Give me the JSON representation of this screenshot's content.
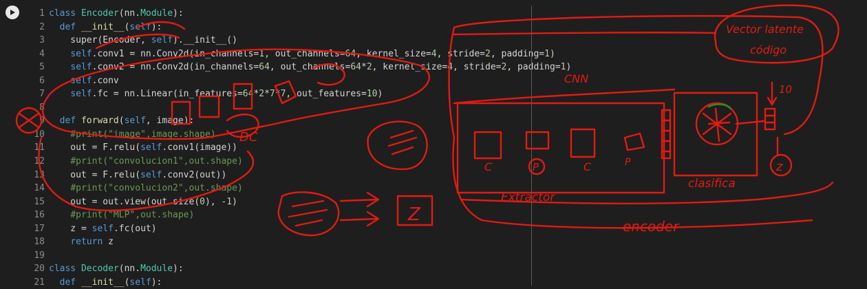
{
  "code_lines": [
    {
      "n": "1",
      "parts": [
        [
          "kw",
          "class "
        ],
        [
          "cls",
          "Encoder"
        ],
        [
          "t",
          "(nn."
        ],
        [
          "cls",
          "Module"
        ],
        [
          "t",
          "):"
        ]
      ]
    },
    {
      "n": "2",
      "parts": [
        [
          "t",
          "  "
        ],
        [
          "kw",
          "def "
        ],
        [
          "fn",
          "__init__"
        ],
        [
          "t",
          "("
        ],
        [
          "self",
          "self"
        ],
        [
          "t",
          "):"
        ]
      ]
    },
    {
      "n": "3",
      "parts": [
        [
          "t",
          "    super(Encoder, "
        ],
        [
          "self",
          "self"
        ],
        [
          "t",
          ").__init__()"
        ]
      ]
    },
    {
      "n": "4",
      "parts": [
        [
          "t",
          "    "
        ],
        [
          "self",
          "self"
        ],
        [
          "t",
          ".conv1 = nn.Conv2d(in_channels="
        ],
        [
          "num",
          "1"
        ],
        [
          "t",
          ", out_channels="
        ],
        [
          "num",
          "64"
        ],
        [
          "t",
          ", kernel_size="
        ],
        [
          "num",
          "4"
        ],
        [
          "t",
          ", stride="
        ],
        [
          "num",
          "2"
        ],
        [
          "t",
          ", padding="
        ],
        [
          "num",
          "1"
        ],
        [
          "t",
          ")"
        ]
      ]
    },
    {
      "n": "5",
      "parts": [
        [
          "t",
          "    "
        ],
        [
          "self",
          "self"
        ],
        [
          "t",
          ".conv2 = nn.Conv2d(in_channels="
        ],
        [
          "num",
          "64"
        ],
        [
          "t",
          ", out_channels="
        ],
        [
          "num",
          "64"
        ],
        [
          "t",
          "*"
        ],
        [
          "num",
          "2"
        ],
        [
          "t",
          ", kernel_size="
        ],
        [
          "num",
          "4"
        ],
        [
          "t",
          ", stride="
        ],
        [
          "num",
          "2"
        ],
        [
          "t",
          ", padding="
        ],
        [
          "num",
          "1"
        ],
        [
          "t",
          ")"
        ]
      ]
    },
    {
      "n": "6",
      "parts": [
        [
          "t",
          "    "
        ],
        [
          "self",
          "self"
        ],
        [
          "t",
          ".conv"
        ]
      ]
    },
    {
      "n": "7",
      "parts": [
        [
          "t",
          "    "
        ],
        [
          "self",
          "self"
        ],
        [
          "t",
          ".fc = nn.Linear(in_features="
        ],
        [
          "num",
          "64"
        ],
        [
          "t",
          "*"
        ],
        [
          "num",
          "2"
        ],
        [
          "t",
          "*"
        ],
        [
          "num",
          "7"
        ],
        [
          "t",
          "*"
        ],
        [
          "num",
          "7"
        ],
        [
          "t",
          ", out_features="
        ],
        [
          "num",
          "10"
        ],
        [
          "t",
          ")"
        ]
      ]
    },
    {
      "n": "8",
      "parts": []
    },
    {
      "n": "9",
      "parts": [
        [
          "t",
          "  "
        ],
        [
          "kw",
          "def "
        ],
        [
          "fn",
          "forward"
        ],
        [
          "t",
          "("
        ],
        [
          "self",
          "self"
        ],
        [
          "t",
          ", image):"
        ]
      ]
    },
    {
      "n": "10",
      "parts": [
        [
          "t",
          "    "
        ],
        [
          "cm",
          "#print(\"image\",image.shape)"
        ]
      ]
    },
    {
      "n": "11",
      "parts": [
        [
          "t",
          "    out = F.relu("
        ],
        [
          "self",
          "self"
        ],
        [
          "t",
          ".conv1(image))"
        ]
      ]
    },
    {
      "n": "12",
      "parts": [
        [
          "t",
          "    "
        ],
        [
          "cm",
          "#print(\"convolucion1\",out.shape)"
        ]
      ]
    },
    {
      "n": "13",
      "parts": [
        [
          "t",
          "    out = F.relu("
        ],
        [
          "self",
          "self"
        ],
        [
          "t",
          ".conv2(out))"
        ]
      ]
    },
    {
      "n": "14",
      "parts": [
        [
          "t",
          "    "
        ],
        [
          "cm",
          "#print(\"convolucion2\",out.shape)"
        ]
      ]
    },
    {
      "n": "15",
      "parts": [
        [
          "t",
          "    out = out.view(out.size("
        ],
        [
          "num",
          "0"
        ],
        [
          "t",
          "), -"
        ],
        [
          "num",
          "1"
        ],
        [
          "t",
          ")"
        ]
      ]
    },
    {
      "n": "16",
      "parts": [
        [
          "t",
          "    "
        ],
        [
          "cm",
          "#print(\"MLP\",out.shape)"
        ]
      ]
    },
    {
      "n": "17",
      "parts": [
        [
          "t",
          "    z = "
        ],
        [
          "self",
          "self"
        ],
        [
          "t",
          ".fc(out)"
        ]
      ]
    },
    {
      "n": "18",
      "parts": [
        [
          "t",
          "    "
        ],
        [
          "kw",
          "return "
        ],
        [
          "t",
          "z"
        ]
      ]
    },
    {
      "n": "19",
      "parts": []
    },
    {
      "n": "20",
      "parts": [
        [
          "kw",
          "class "
        ],
        [
          "cls",
          "Decoder"
        ],
        [
          "t",
          "(nn."
        ],
        [
          "cls",
          "Module"
        ],
        [
          "t",
          "):"
        ]
      ]
    },
    {
      "n": "21",
      "parts": [
        [
          "t",
          "  "
        ],
        [
          "kw",
          "def "
        ],
        [
          "fn",
          "__init__"
        ],
        [
          "t",
          "("
        ],
        [
          "self",
          "self"
        ],
        [
          "t",
          "):"
        ]
      ]
    }
  ],
  "annotations": {
    "vector_latent": "Vector latente",
    "codigo": "código",
    "size_10": "10",
    "z_label": "z",
    "z_box": "Z",
    "extractor": "Extractor",
    "clasificador": "clasifica",
    "encoder": "encoder",
    "c1": "C",
    "p1": "P",
    "c2": "C",
    "p2": "P",
    "cnn": "CNN"
  },
  "colors": {
    "ink": "#e21b12",
    "background": "#1e1e1e"
  }
}
